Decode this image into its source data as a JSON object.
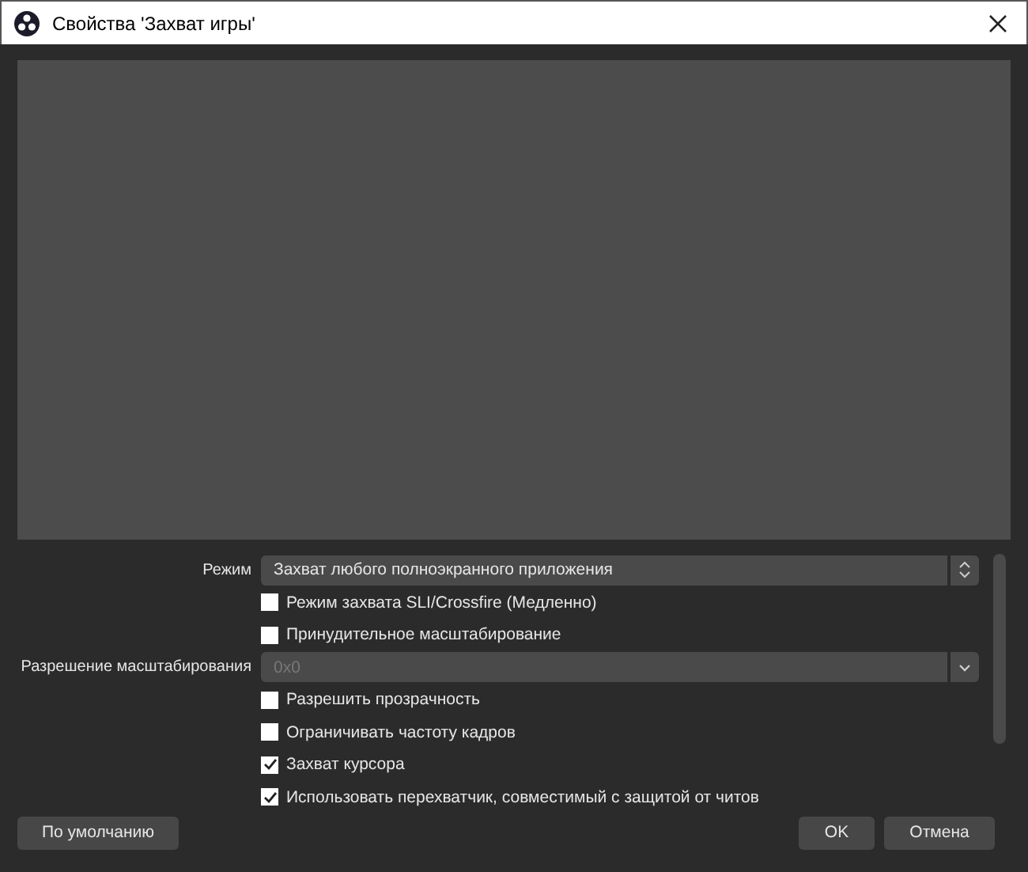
{
  "window": {
    "title": "Свойства 'Захват игры'"
  },
  "settings": [
    {
      "kind": "select",
      "label": "Режим",
      "value": "Захват любого полноэкранного приложения",
      "stepper": true,
      "disabled": false
    },
    {
      "kind": "checkbox",
      "label": "Режим захвата SLI/Crossfire (Медленно)",
      "checked": false
    },
    {
      "kind": "checkbox",
      "label": "Принудительное масштабирование",
      "checked": false
    },
    {
      "kind": "select",
      "label": "Разрешение масштабирования",
      "value": "0x0",
      "stepper": false,
      "disabled": true
    },
    {
      "kind": "checkbox",
      "label": "Разрешить прозрачность",
      "checked": false
    },
    {
      "kind": "checkbox",
      "label": "Ограничивать частоту кадров",
      "checked": false
    },
    {
      "kind": "checkbox",
      "label": "Захват курсора",
      "checked": true
    },
    {
      "kind": "checkbox",
      "label": "Использовать перехватчик, совместимый с защитой от читов",
      "checked": true
    }
  ],
  "buttons": {
    "defaults": "По умолчанию",
    "ok": "OK",
    "cancel": "Отмена"
  }
}
